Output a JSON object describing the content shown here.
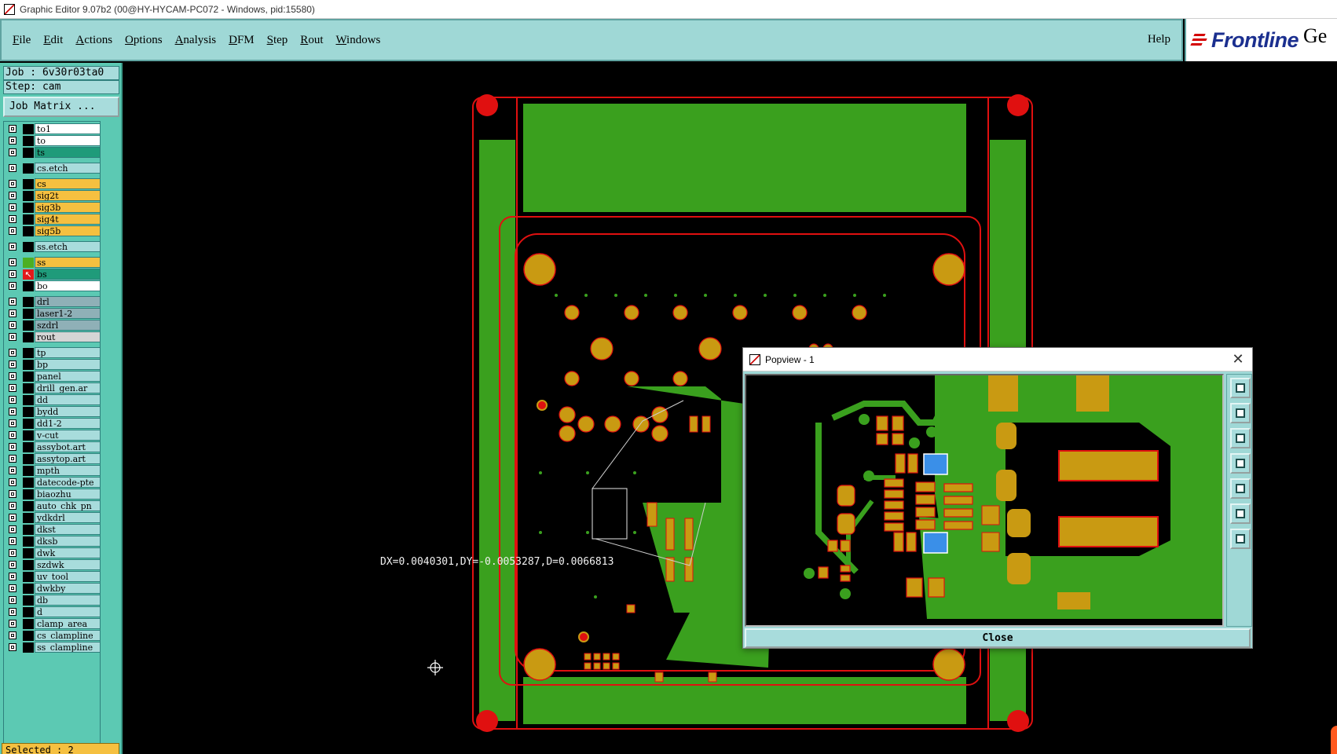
{
  "window": {
    "title": "Graphic Editor 9.07b2 (00@HY-HYCAM-PC072 - Windows, pid:15580)"
  },
  "menu": {
    "items": [
      {
        "label": "File",
        "underline": "F",
        "rest": "ile"
      },
      {
        "label": "Edit",
        "underline": "E",
        "rest": "dit"
      },
      {
        "label": "Actions",
        "underline": "A",
        "rest": "ctions"
      },
      {
        "label": "Options",
        "underline": "O",
        "rest": "ptions"
      },
      {
        "label": "Analysis",
        "underline": "A",
        "rest": "nalysis"
      },
      {
        "label": "DFM",
        "underline": "D",
        "rest": "FM"
      },
      {
        "label": "Step",
        "underline": "S",
        "rest": "tep"
      },
      {
        "label": "Rout",
        "underline": "R",
        "rest": "out"
      },
      {
        "label": "Windows",
        "underline": "W",
        "rest": "indows"
      }
    ],
    "help": "Help"
  },
  "brand": {
    "name": "Frontline",
    "suffix": "Ge",
    "accent": "#d40000",
    "color": "#1b2f8f"
  },
  "job": {
    "job_label": "Job : 6v30r03ta0",
    "step_label": "Step: cam",
    "matrix_button": "Job Matrix ..."
  },
  "layers": [
    {
      "name": "to1",
      "color": "#ffffff",
      "sel": "#000000"
    },
    {
      "name": "to",
      "color": "#ffffff",
      "sel": "#000000"
    },
    {
      "name": "ts",
      "color": "#1f9b7a",
      "sel": "#000000"
    },
    {
      "name": "cs.etch",
      "color": "#a8dcdc",
      "sel": "#000000"
    },
    {
      "name": "cs",
      "color": "#f5c040",
      "sel": "#000000"
    },
    {
      "name": "sig2t",
      "color": "#f5c040",
      "sel": "#000000"
    },
    {
      "name": "sig3b",
      "color": "#f5c040",
      "sel": "#000000"
    },
    {
      "name": "sig4t",
      "color": "#f5c040",
      "sel": "#000000"
    },
    {
      "name": "sig5b",
      "color": "#f5c040",
      "sel": "#000000"
    },
    {
      "name": "ss.etch",
      "color": "#a8dcdc",
      "sel": "#000000"
    },
    {
      "name": "ss",
      "color": "#f5c040",
      "sel": "#4caf22"
    },
    {
      "name": "bs",
      "color": "#1f9b7a",
      "sel": "#e21a1a"
    },
    {
      "name": "bo",
      "color": "#ffffff",
      "sel": "#000000"
    },
    {
      "name": "drl",
      "color": "#8fb0b7",
      "sel": "#000000"
    },
    {
      "name": "laser1-2",
      "color": "#8fb0b7",
      "sel": "#000000"
    },
    {
      "name": "szdrl",
      "color": "#8fb0b7",
      "sel": "#000000"
    },
    {
      "name": "rout",
      "color": "#d5d5d5",
      "sel": "#000000"
    },
    {
      "name": "tp",
      "color": "#a8dcdc",
      "sel": "#000000"
    },
    {
      "name": "bp",
      "color": "#a8dcdc",
      "sel": "#000000"
    },
    {
      "name": "panel",
      "color": "#a8dcdc",
      "sel": "#000000"
    },
    {
      "name": "drill_gen.ar",
      "color": "#a8dcdc",
      "sel": "#000000"
    },
    {
      "name": "dd",
      "color": "#a8dcdc",
      "sel": "#000000"
    },
    {
      "name": "bydd",
      "color": "#a8dcdc",
      "sel": "#000000"
    },
    {
      "name": "dd1-2",
      "color": "#a8dcdc",
      "sel": "#000000"
    },
    {
      "name": "v-cut",
      "color": "#a8dcdc",
      "sel": "#000000"
    },
    {
      "name": "assybot.art",
      "color": "#a8dcdc",
      "sel": "#000000"
    },
    {
      "name": "assytop.art",
      "color": "#a8dcdc",
      "sel": "#000000"
    },
    {
      "name": "mpth",
      "color": "#a8dcdc",
      "sel": "#000000"
    },
    {
      "name": "datecode-pte",
      "color": "#a8dcdc",
      "sel": "#000000"
    },
    {
      "name": "biaozhu",
      "color": "#a8dcdc",
      "sel": "#000000"
    },
    {
      "name": "auto_chk_pn",
      "color": "#a8dcdc",
      "sel": "#000000"
    },
    {
      "name": "ydkdrl",
      "color": "#a8dcdc",
      "sel": "#000000"
    },
    {
      "name": "dkst",
      "color": "#a8dcdc",
      "sel": "#000000"
    },
    {
      "name": "dksb",
      "color": "#a8dcdc",
      "sel": "#000000"
    },
    {
      "name": "dwk",
      "color": "#a8dcdc",
      "sel": "#000000"
    },
    {
      "name": "szdwk",
      "color": "#a8dcdc",
      "sel": "#000000"
    },
    {
      "name": "uv_tool",
      "color": "#a8dcdc",
      "sel": "#000000"
    },
    {
      "name": "dwkby",
      "color": "#a8dcdc",
      "sel": "#000000"
    },
    {
      "name": "db",
      "color": "#a8dcdc",
      "sel": "#000000"
    },
    {
      "name": "d",
      "color": "#a8dcdc",
      "sel": "#000000"
    },
    {
      "name": "clamp_area",
      "color": "#a8dcdc",
      "sel": "#000000"
    },
    {
      "name": "cs_clampline",
      "color": "#a8dcdc",
      "sel": "#000000"
    },
    {
      "name": "ss_clampline",
      "color": "#a8dcdc",
      "sel": "#000000"
    }
  ],
  "status": {
    "selected": "Selected : 2"
  },
  "canvas": {
    "measurement": "DX=0.0040301,DY=-0.0053287,D=0.0066813"
  },
  "popview": {
    "title": "Popview - 1",
    "close_button": "Close",
    "close_icon": "close-icon"
  },
  "colors": {
    "board_green": "#3aa01e",
    "copper": "#c99a12",
    "outline_red": "#e01010",
    "selected_blue": "#3a8fe8",
    "panel_teal": "#9fd8d6"
  }
}
